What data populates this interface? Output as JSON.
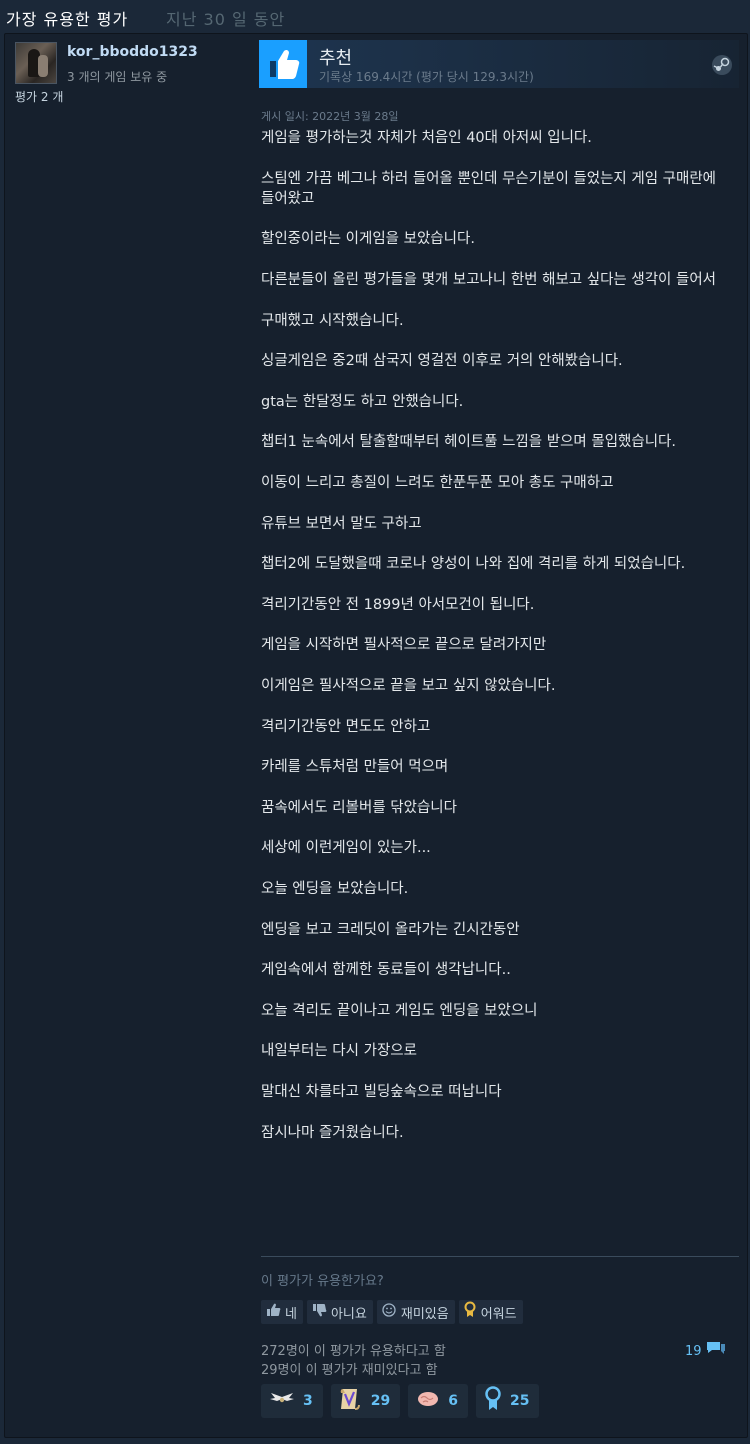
{
  "header": {
    "title": "가장 유용한 평가",
    "period": "지난 30 일 동안"
  },
  "author": {
    "name": "kor_bboddo1323",
    "owned": "3 개의 게임 보유 중",
    "reviews": "평가 2 개"
  },
  "vote": {
    "title": "추천",
    "hours": "기록상 169.4시간 (평가 당시 129.3시간)",
    "thumb_icon": "thumbs-up-icon",
    "platform_icon": "steam-icon"
  },
  "posted": "게시 일시: 2022년 3월 28일",
  "review": {
    "paragraphs": [
      "게임을 평가하는것 자체가 처음인 40대 아저씨 입니다.",
      "스팀엔 가끔 베그나 하러 들어올 뿐인데 무슨기분이 들었는지 게임 구매란에 들어왔고",
      "할인중이라는 이게임을 보았습니다.",
      "다른분들이 올린 평가들을 몇개 보고나니 한번 해보고 싶다는 생각이 들어서",
      "구매했고 시작했습니다.",
      "싱글게임은 중2때 삼국지 영걸전 이후로 거의 안해봤습니다.",
      "gta는 한달정도 하고 안했습니다.",
      "챕터1 눈속에서 탈출할때부터 헤이트풀 느낌을 받으며 몰입했습니다.",
      "이동이 느리고 총질이 느려도 한푼두푼 모아 총도 구매하고",
      "유튜브 보면서 말도 구하고",
      "챕터2에 도달했을때 코로나 양성이 나와 집에 격리를 하게 되었습니다.",
      "격리기간동안 전 1899년 아서모건이 됩니다.",
      "게임을 시작하면 필사적으로 끝으로 달려가지만",
      "이게임은 필사적으로 끝을 보고 싶지 않았습니다.",
      "격리기간동안 면도도 안하고",
      "카레를 스튜처럼 만들어 먹으며",
      "꿈속에서도 리볼버를 닦았습니다",
      "세상에 이런게임이 있는가...",
      "오늘 엔딩을 보았습니다.",
      "엔딩을 보고 크레딧이 올라가는 긴시간동안",
      "게임속에서 함께한 동료들이 생각납니다..",
      "오늘 격리도 끝이나고 게임도 엔딩을 보았으니",
      "내일부터는 다시 가장으로",
      "말대신 차를타고 빌딩숲속으로 떠납니다",
      "잠시나마 즐거웠습니다."
    ]
  },
  "helpful": {
    "question": "이 평가가 유용한가요?",
    "yes": "네",
    "no": "아니요",
    "funny": "재미있음",
    "award": "어워드"
  },
  "stats": {
    "helpful_count": "272명이 이 평가가 유용하다고 함",
    "funny_count": "29명이 이 평가가 재미있다고 함",
    "comments": "19"
  },
  "awards": [
    {
      "icon": "wings-icon",
      "count": "3"
    },
    {
      "icon": "scroll-icon",
      "count": "29"
    },
    {
      "icon": "brain-icon",
      "count": "6"
    },
    {
      "icon": "medal-icon",
      "count": "25"
    }
  ],
  "colors": {
    "accent": "#66c0f4",
    "background": "#1b2838",
    "thumb": "#1a9fff"
  }
}
